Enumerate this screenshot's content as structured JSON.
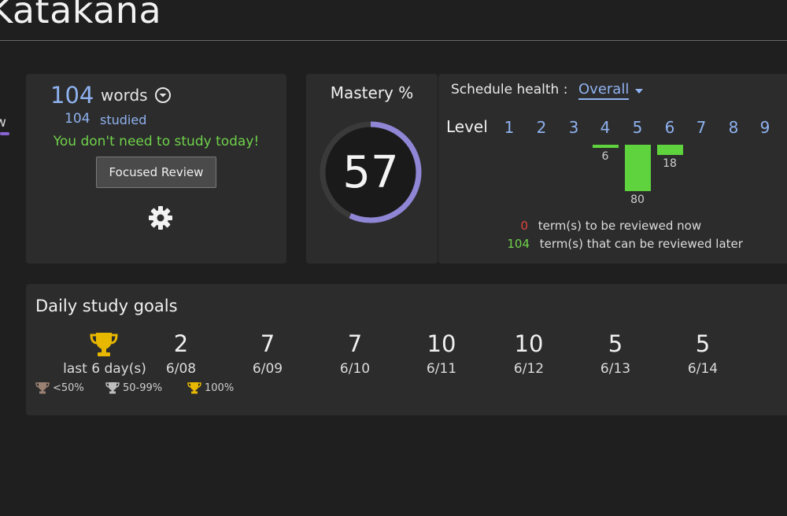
{
  "page": {
    "title": "Katakana",
    "left_tab": "w"
  },
  "words_card": {
    "count": "104",
    "label": "words",
    "studied_count": "104",
    "studied_label": "studied",
    "message": "You don't need to study today!",
    "focused_review_label": "Focused Review"
  },
  "mastery": {
    "title": "Mastery %",
    "value": "57",
    "percent": 57
  },
  "schedule": {
    "label": "Schedule health :",
    "selected": "Overall",
    "level_label": "Level",
    "levels": [
      "1",
      "2",
      "3",
      "4",
      "5",
      "6",
      "7",
      "8",
      "9"
    ],
    "histogram": [
      {
        "level": "4",
        "value": 6
      },
      {
        "level": "5",
        "value": 80
      },
      {
        "level": "6",
        "value": 18
      }
    ],
    "review_now_count": "0",
    "review_now_text": "term(s) to be reviewed now",
    "review_later_count": "104",
    "review_later_text": "term(s) that can be reviewed later"
  },
  "daily_goals": {
    "title": "Daily study goals",
    "streak_text": "last 6 day(s)",
    "legend": [
      {
        "label": "<50%",
        "color": "#9a8172"
      },
      {
        "label": "50-99%",
        "color": "#bdbdbd"
      },
      {
        "label": "100%",
        "color": "#e8b800"
      }
    ],
    "days": [
      {
        "value": "2",
        "date": "6/08"
      },
      {
        "value": "7",
        "date": "6/09"
      },
      {
        "value": "7",
        "date": "6/10"
      },
      {
        "value": "10",
        "date": "6/11"
      },
      {
        "value": "10",
        "date": "6/12"
      },
      {
        "value": "5",
        "date": "6/13"
      },
      {
        "value": "5",
        "date": "6/14"
      }
    ]
  },
  "colors": {
    "accent_blue": "#8fb2f0",
    "green": "#5fd33d",
    "red": "#e0463a",
    "ring": "#8f86d6",
    "trophy_gold": "#e8b800"
  }
}
